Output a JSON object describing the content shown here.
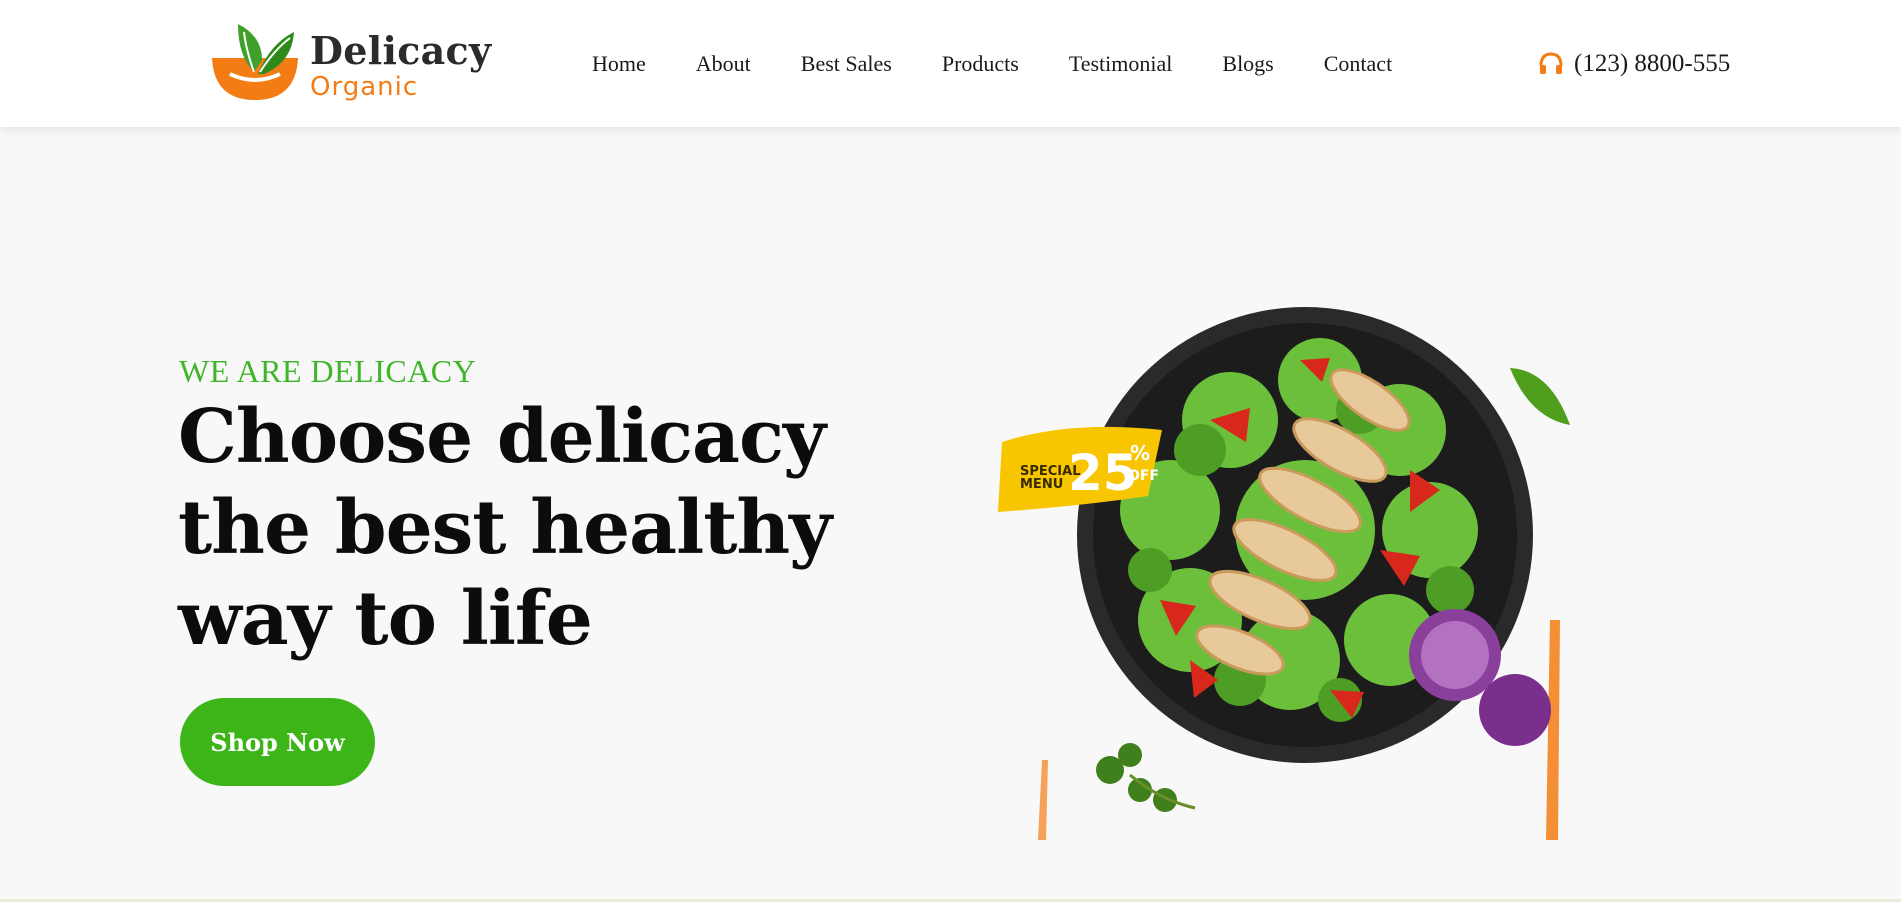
{
  "header": {
    "logo": {
      "name": "Delicacy",
      "sub": "Organic"
    },
    "nav": [
      {
        "label": "Home"
      },
      {
        "label": "About"
      },
      {
        "label": "Best Sales"
      },
      {
        "label": "Products"
      },
      {
        "label": "Testimonial"
      },
      {
        "label": "Blogs"
      },
      {
        "label": "Contact"
      }
    ],
    "phone": {
      "icon": "headphones-icon",
      "number": "(123) 8800-555"
    }
  },
  "hero": {
    "eyebrow": "WE ARE DELICACY",
    "headline_lines": [
      "Choose delicacy",
      "the best healthy",
      "way to life"
    ],
    "cta_label": "Shop Now",
    "badge": {
      "top": "SPECIAL",
      "bottom": "MENU",
      "value": "25",
      "percent": "%",
      "off": "OFF"
    }
  },
  "colors": {
    "accent_green": "#3db518",
    "accent_orange": "#f47c14",
    "badge_yellow": "#f7c600",
    "page_bg": "#f8f8f9"
  }
}
